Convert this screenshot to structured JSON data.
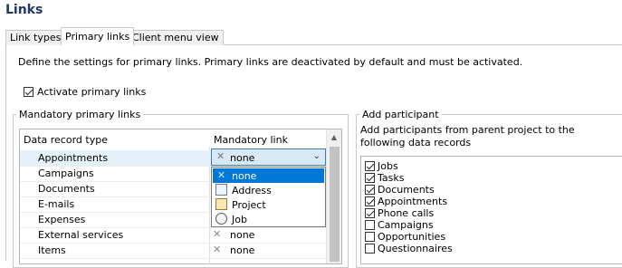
{
  "window": {
    "title": "Links"
  },
  "tabs": [
    {
      "label": "Link types",
      "active": false
    },
    {
      "label": "Primary links",
      "active": true
    },
    {
      "label": "Client menu view",
      "active": false
    }
  ],
  "description": "Define the settings for primary links. Primary links are deactivated by default and must be activated.",
  "activate": {
    "label": "Activate primary links",
    "checked": true
  },
  "mandatory": {
    "group_title": "Mandatory primary links",
    "col_type": "Data record type",
    "col_link": "Mandatory link",
    "rows": [
      {
        "type": "Appointments",
        "link": "none",
        "selected": true
      },
      {
        "type": "Campaigns",
        "link": ""
      },
      {
        "type": "Documents",
        "link": ""
      },
      {
        "type": "E-mails",
        "link": ""
      },
      {
        "type": "Expenses",
        "link": ""
      },
      {
        "type": "External services",
        "link": "none"
      },
      {
        "type": "Items",
        "link": "none"
      }
    ],
    "combo": {
      "value": "none"
    },
    "dropdown": [
      {
        "label": "none",
        "icon": "clear-icon",
        "selected": true
      },
      {
        "label": "Address",
        "icon": "address-card-icon"
      },
      {
        "label": "Project",
        "icon": "project-folder-icon"
      },
      {
        "label": "Job",
        "icon": "job-gear-icon"
      }
    ]
  },
  "participant": {
    "group_title": "Add participant",
    "description": "Add participants from parent project to the following data records",
    "items": [
      {
        "label": "Jobs",
        "checked": true
      },
      {
        "label": "Tasks",
        "checked": true
      },
      {
        "label": "Documents",
        "checked": true
      },
      {
        "label": "Appointments",
        "checked": true
      },
      {
        "label": "Phone calls",
        "checked": true
      },
      {
        "label": "Campaigns",
        "checked": false
      },
      {
        "label": "Opportunities",
        "checked": false
      },
      {
        "label": "Questionnaires",
        "checked": false
      }
    ]
  },
  "colors": {
    "title": "#1f3864",
    "selection": "#0078d7",
    "row_highlight": "#e6f0fa"
  }
}
